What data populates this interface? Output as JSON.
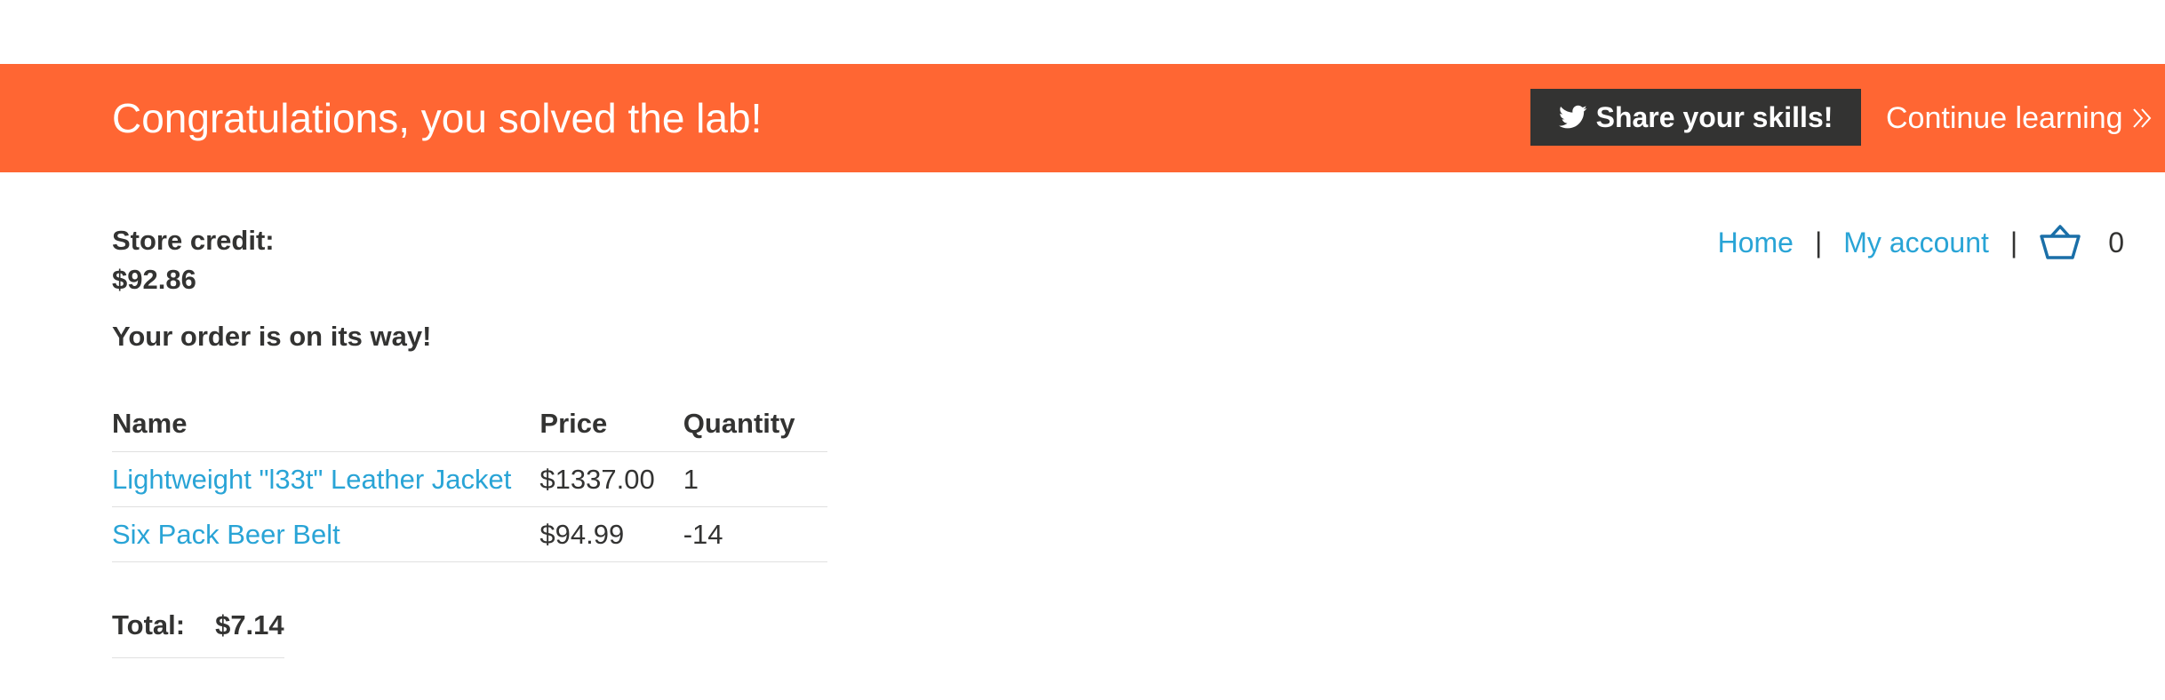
{
  "banner": {
    "title": "Congratulations, you solved the lab!",
    "share_label": "Share your skills!",
    "continue_label": "Continue learning",
    "color": "#ff6633"
  },
  "nav": {
    "home": "Home",
    "my_account": "My account",
    "separator": "|",
    "cart_count": "0",
    "cart_icon": "basket-icon"
  },
  "account": {
    "credit_label": "Store credit:",
    "credit_value": "$92.86"
  },
  "order": {
    "message": "Your order is on its way!",
    "columns": [
      "Name",
      "Price",
      "Quantity"
    ],
    "rows": [
      {
        "name": "Lightweight \"l33t\" Leather Jacket",
        "price": "$1337.00",
        "quantity": "1"
      },
      {
        "name": "Six Pack Beer Belt",
        "price": "$94.99",
        "quantity": "-14"
      }
    ],
    "total_label": "Total:",
    "total_value": "$7.14"
  },
  "colors": {
    "link": "#29a4d6",
    "text": "#333332",
    "button_bg": "#333332"
  }
}
